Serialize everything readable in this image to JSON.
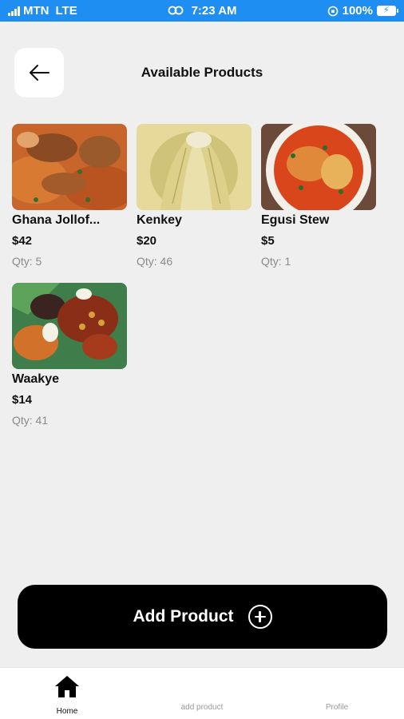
{
  "status_bar": {
    "carrier": "MTN",
    "network": "LTE",
    "time": "7:23 AM",
    "battery": "100%"
  },
  "header": {
    "title": "Available Products",
    "back_icon": "arrow-left-icon"
  },
  "products": [
    {
      "name": "Ghana Jollof...",
      "price": "$42",
      "qty": "Qty: 5"
    },
    {
      "name": "Kenkey",
      "price": "$20",
      "qty": "Qty: 46"
    },
    {
      "name": "Egusi Stew",
      "price": "$5",
      "qty": "Qty: 1"
    },
    {
      "name": "Waakye",
      "price": "$14",
      "qty": "Qty: 41"
    }
  ],
  "add_button": {
    "label": "Add Product",
    "icon": "plus-circle-icon"
  },
  "tabbar": {
    "home": "Home",
    "add_product": "add product",
    "profile": "Profile"
  },
  "colors": {
    "status_bar": "#1e8ef3",
    "background": "#efefef",
    "primary_button": "#000000",
    "muted_text": "#8a8a8a"
  }
}
